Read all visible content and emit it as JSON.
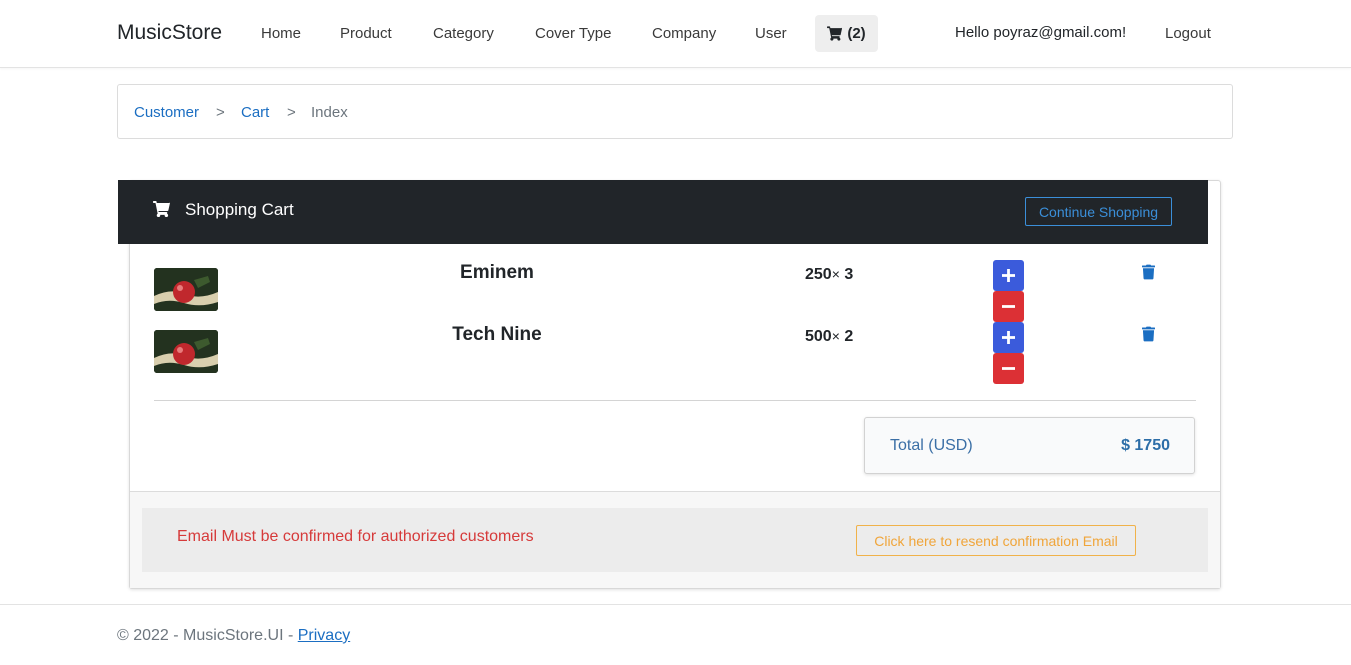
{
  "navbar": {
    "brand": "MusicStore",
    "items": [
      "Home",
      "Product",
      "Category",
      "Cover Type",
      "Company",
      "User"
    ],
    "cart_count": "(2)",
    "greeting": "Hello poyraz@gmail.com!",
    "logout": "Logout"
  },
  "breadcrumb": {
    "items": [
      "Customer",
      "Cart",
      "Index"
    ],
    "separator": ">"
  },
  "cart": {
    "title": "Shopping Cart",
    "continue_label": "Continue Shopping",
    "items": [
      {
        "name": "Eminem",
        "price": "250",
        "times": "×",
        "qty": "3"
      },
      {
        "name": "Tech Nine",
        "price": "500",
        "times": "×",
        "qty": "2"
      }
    ],
    "total_label": "Total (USD)",
    "total_value": "$ 1750"
  },
  "notice": {
    "message": "Email Must be confirmed for authorized customers",
    "resend_label": "Click here to resend confirmation Email"
  },
  "footer": {
    "copyright": "© 2022 - MusicStore.UI - ",
    "privacy": "Privacy"
  },
  "colors": {
    "header_bg": "#212529",
    "link": "#1b6ec2",
    "plus": "#3b5bdb",
    "minus": "#dc3035",
    "trash": "#1b6ec2",
    "warning": "#f0a53a",
    "danger_text": "#d63a3a"
  }
}
